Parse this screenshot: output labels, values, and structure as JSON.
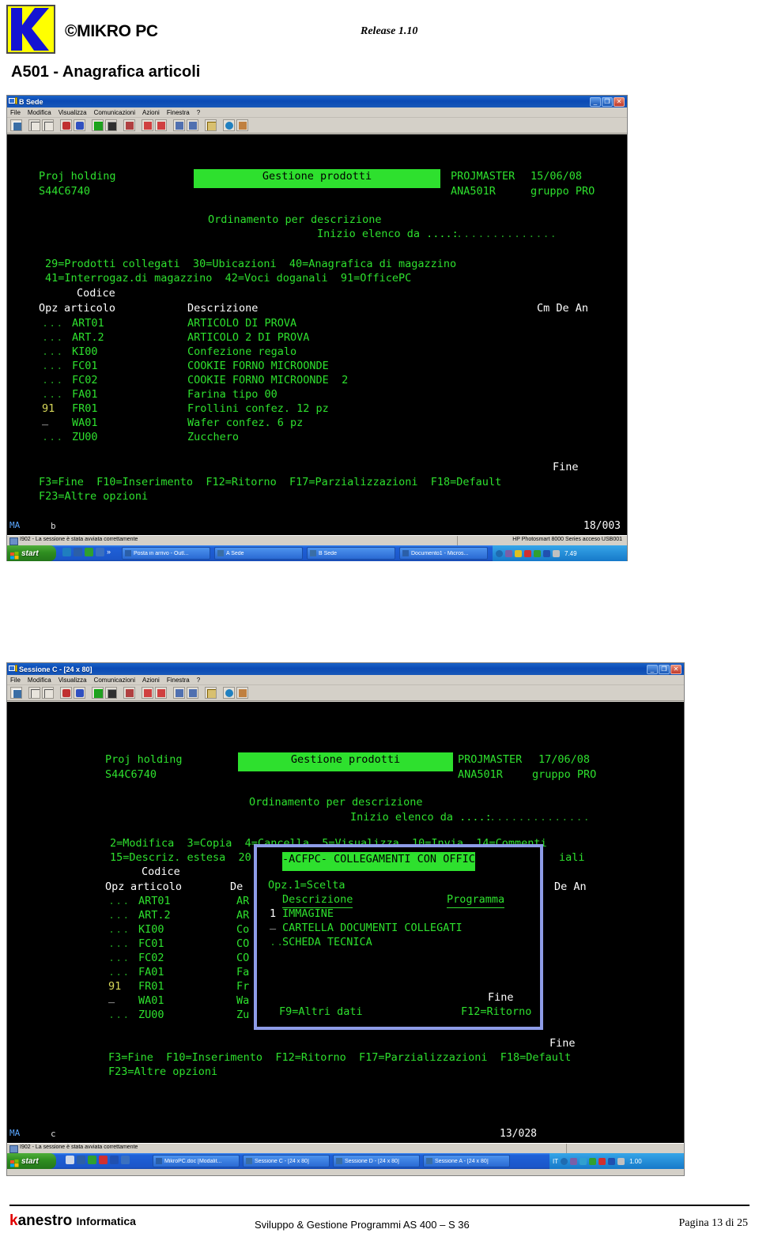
{
  "doc": {
    "brand": "©MIKRO PC",
    "release": "Release 1.10",
    "title": "A501 - Anagrafica articoli",
    "logo_name": "mikro-pc-logo"
  },
  "footer": {
    "brand_k": "k",
    "brand_rest": "anestro",
    "brand_sub": "Informatica",
    "center": "Sviluppo & Gestione Programmi AS 400 – S 36",
    "page": "Pagina 13 di 25"
  },
  "window1": {
    "title": "B Sede",
    "menu": [
      "File",
      "Modifica",
      "Visualizza",
      "Comunicazioni",
      "Azioni",
      "Finestra",
      "?"
    ],
    "buttons": {
      "minimize": "_",
      "maximize": "❐",
      "close": "✕"
    },
    "screen": {
      "company": "Proj holding",
      "system": "S44C6740",
      "heading": "Gestione prodotti",
      "master": "PROJMASTER",
      "date": "15/06/08",
      "program": "ANA501R",
      "group": "gruppo PRO",
      "sort": "Ordinamento per descrizione",
      "start_label": "Inizio elenco da ....:",
      "start_dots": "..............",
      "options_line1": "29=Prodotti collegati  30=Ubicazioni  40=Anagrafica di magazzino",
      "options_line2": "41=Interrogaz.di magazzino  42=Voci doganali  91=OfficePC",
      "col_codice": "Codice",
      "col_opz": "Opz",
      "col_articolo": "articolo",
      "col_descrizione": "Descrizione",
      "col_right": "Cm De An",
      "rows": [
        {
          "opz": "...",
          "codice": "ART01",
          "descrizione": "ARTICOLO DI PROVA"
        },
        {
          "opz": "...",
          "codice": "ART.2",
          "descrizione": "ARTICOLO 2 DI PROVA"
        },
        {
          "opz": "...",
          "codice": "KI00",
          "descrizione": "Confezione regalo"
        },
        {
          "opz": "...",
          "codice": "FC01",
          "descrizione": "COOKIE FORNO MICROONDE"
        },
        {
          "opz": "...",
          "codice": "FC02",
          "descrizione": "COOKIE FORNO MICROONDE  2"
        },
        {
          "opz": "...",
          "codice": "FA01",
          "descrizione": "Farina tipo 00"
        },
        {
          "opz": "91",
          "codice": "FR01",
          "descrizione": "Frollini confez. 12 pz"
        },
        {
          "opz": "_",
          "codice": "WA01",
          "descrizione": "Wafer confez. 6 pz"
        },
        {
          "opz": "...",
          "codice": "ZU00",
          "descrizione": "Zucchero"
        }
      ],
      "fine": "Fine",
      "fkeys1": "F3=Fine  F10=Inserimento  F12=Ritorno  F17=Parzializzazioni  F18=Default",
      "fkeys2": "F23=Altre opzioni"
    },
    "oia": {
      "ma": "MA",
      "mode": "b",
      "position": "18/003"
    },
    "status": {
      "left": "I902 - La sessione è stata avviata correttamente",
      "right": "HP Photosmart 8000 Series acceso USB001"
    },
    "taskbar": {
      "start": "start",
      "items": [
        {
          "label": "Posta in arrivo - Outl...",
          "icon": "outlook-icon"
        },
        {
          "label": "A Sede",
          "icon": "terminal-icon"
        },
        {
          "label": "B Sede",
          "icon": "terminal-icon"
        },
        {
          "label": "Documento1 - Micros...",
          "icon": "word-icon"
        }
      ],
      "clock": "7.49"
    }
  },
  "window2": {
    "title": "Sessione C - [24 x 80]",
    "menu": [
      "File",
      "Modifica",
      "Visualizza",
      "Comunicazioni",
      "Azioni",
      "Finestra",
      "?"
    ],
    "buttons": {
      "minimize": "_",
      "maximize": "❐",
      "close": "✕"
    },
    "screen": {
      "company": "Proj holding",
      "system": "S44C6740",
      "heading": "Gestione prodotti",
      "master": "PROJMASTER",
      "date": "17/06/08",
      "program": "ANA501R",
      "group": "gruppo PRO",
      "sort": "Ordinamento per descrizione",
      "start_label": "Inizio elenco da ....:",
      "start_dots": "..............",
      "options_line1": "2=Modifica  3=Copia  4=Cancella  5=Visualizza  10=Invia  14=Commenti",
      "options_line2a": "15=Descriz. estesa  20",
      "options_line2b": "iali",
      "col_codice": "Codice",
      "col_opz": "Opz",
      "col_articolo": "articolo",
      "col_de": "De",
      "col_right": "De An",
      "rows": [
        {
          "opz": "...",
          "codice": "ART01",
          "descrizione": "AR"
        },
        {
          "opz": "...",
          "codice": "ART.2",
          "descrizione": "AR"
        },
        {
          "opz": "...",
          "codice": "KI00",
          "descrizione": "Co"
        },
        {
          "opz": "...",
          "codice": "FC01",
          "descrizione": "CO"
        },
        {
          "opz": "...",
          "codice": "FC02",
          "descrizione": "CO"
        },
        {
          "opz": "...",
          "codice": "FA01",
          "descrizione": "Fa"
        },
        {
          "opz": "91",
          "codice": "FR01",
          "descrizione": "Fr"
        },
        {
          "opz": "_",
          "codice": "WA01",
          "descrizione": "Wa"
        },
        {
          "opz": "...",
          "codice": "ZU00",
          "descrizione": "Zu"
        }
      ],
      "fine": "Fine",
      "fkeys1": "F3=Fine  F10=Inserimento  F12=Ritorno  F17=Parzializzazioni  F18=Default",
      "fkeys2": "F23=Altre opzioni"
    },
    "popup": {
      "heading": "-ACFPC- COLLEGAMENTI CON OFFIC",
      "opz_label": "Opz.1=Scelta",
      "col_descrizione": "Descrizione",
      "col_programma": "Programma",
      "rows": [
        {
          "opz": "1",
          "descrizione": "IMMAGINE"
        },
        {
          "opz": "_",
          "descrizione": "CARTELLA DOCUMENTI COLLEGATI"
        },
        {
          "opz": "..",
          "descrizione": "SCHEDA TECNICA"
        }
      ],
      "fine": "Fine",
      "fkey_f9": "F9=Altri dati",
      "fkey_f12": "F12=Ritorno"
    },
    "oia": {
      "ma": "MA",
      "mode": "c",
      "position": "13/028"
    },
    "status": {
      "left": "I902 - La sessione è stata avviata correttamente",
      "right": ""
    },
    "taskbar": {
      "start": "start",
      "items": [
        {
          "label": "MikroPC.doc [Modalit...",
          "icon": "word-icon"
        },
        {
          "label": "Sessione C - [24 x 80]",
          "icon": "terminal-icon"
        },
        {
          "label": "Sessione D - [24 x 80]",
          "icon": "terminal-icon"
        },
        {
          "label": "Sessione A - [24 x 80]",
          "icon": "terminal-icon"
        }
      ],
      "lang": "IT",
      "clock": "1.00"
    }
  },
  "colors": {
    "green": "#33dd33",
    "white": "#ffffff",
    "yellow": "#d8d85a",
    "popup_border": "#8e9ce8",
    "titlebar_blue": "#0a4ab5",
    "accent_red": "#e00000"
  }
}
